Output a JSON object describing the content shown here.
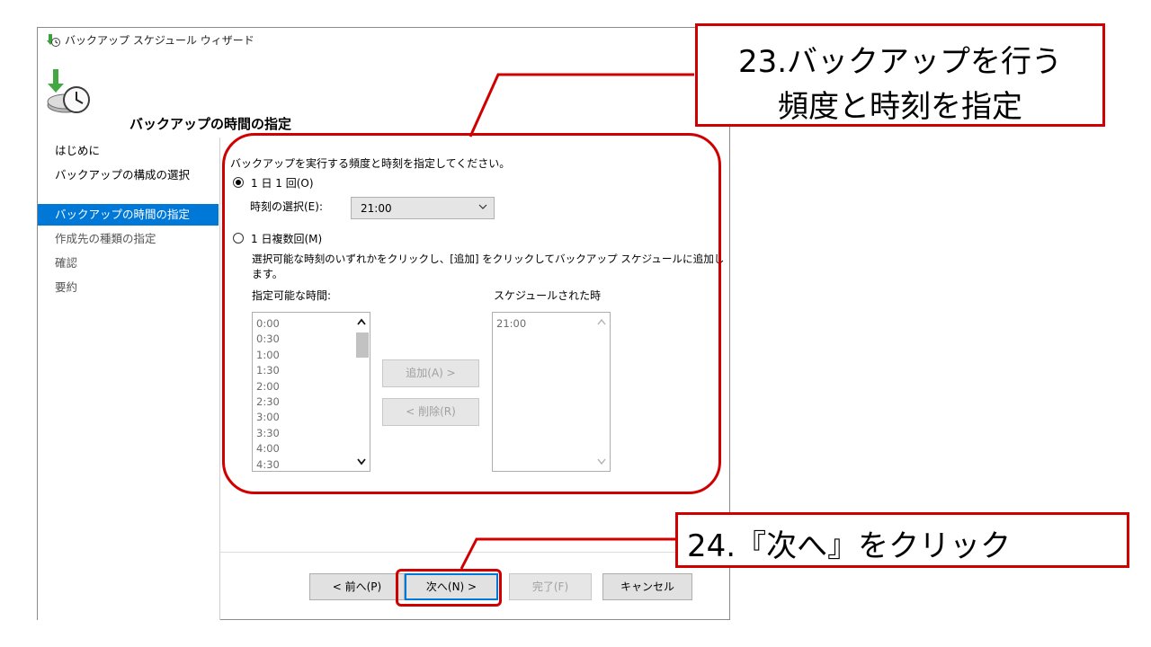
{
  "window": {
    "title": "バックアップ スケジュール ウィザード",
    "header_title": "バックアップの時間の指定"
  },
  "sidebar": {
    "items": [
      {
        "label": "はじめに",
        "state": "normal"
      },
      {
        "label": "バックアップの構成の選択",
        "state": "normal"
      },
      {
        "label": "バックアップの時間の指定",
        "state": "selected"
      },
      {
        "label": "作成先の種類の指定",
        "state": "dim"
      },
      {
        "label": "確認",
        "state": "dim"
      },
      {
        "label": "要約",
        "state": "dim"
      }
    ]
  },
  "content": {
    "instruction": "バックアップを実行する頻度と時刻を指定してください。",
    "once_daily": {
      "label": "1 日 1 回(O)",
      "selected": true
    },
    "time_select_label": "時刻の選択(E):",
    "time_select_value": "21:00",
    "multiple_daily": {
      "label": "1 日複数回(M)",
      "selected": false
    },
    "multiple_desc_line1": "選択可能な時刻のいずれかをクリックし、[追加] をクリックしてバックアップ スケジュールに追加し",
    "multiple_desc_line2": "ます。",
    "available_label": "指定可能な時間:",
    "available_times": [
      "0:00",
      "0:30",
      "1:00",
      "1:30",
      "2:00",
      "2:30",
      "3:00",
      "3:30",
      "4:00",
      "4:30"
    ],
    "scheduled_label": "スケジュールされた時",
    "scheduled_times": [
      "21:00"
    ],
    "add_button": "追加(A) >",
    "remove_button": "< 削除(R)"
  },
  "footer": {
    "prev_button": "< 前へ(P)",
    "next_button": "次へ(N) >",
    "finish_button": "完了(F)",
    "cancel_button": "キャンセル"
  },
  "annotations": {
    "callout_23_line1": "23.バックアップを行う",
    "callout_23_line2": "頻度と時刻を指定",
    "callout_24": "24.『次へ』をクリック",
    "color": "#d00000"
  }
}
